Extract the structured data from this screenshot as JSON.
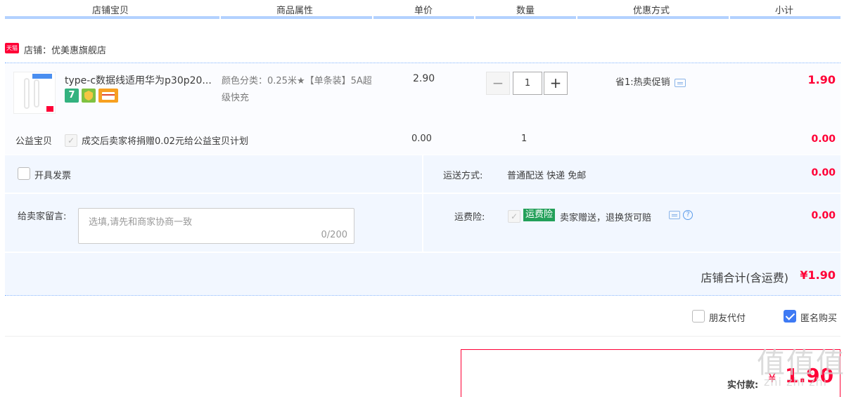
{
  "header": {
    "col_shop_item": "店铺宝贝",
    "col_attr": "商品属性",
    "col_price": "单价",
    "col_qty": "数量",
    "col_promo": "优惠方式",
    "col_subtotal": "小计"
  },
  "shop": {
    "badge": "天猫",
    "name": "店铺：优美惠旗舰店"
  },
  "item": {
    "title": "type-c数据线适用华为p30p20...",
    "attr": "颜色分类：0.25米★【单条装】5A超级快充",
    "price": "2.90",
    "qty": "1",
    "minus": "−",
    "plus": "+",
    "promo": "省1:热卖促销",
    "subtotal": "1.90",
    "icons": [
      "seven-day-return-icon",
      "shield-icon",
      "card-icon"
    ],
    "icon_7_text": "7"
  },
  "charity": {
    "label": "公益宝贝",
    "check": "✓",
    "text": "成交后卖家将捐赠0.02元给公益宝贝计划",
    "price": "0.00",
    "qty": "1",
    "subtotal": "0.00"
  },
  "invoice": {
    "label": "开具发票"
  },
  "shipping": {
    "label": "运送方式:",
    "method": "普通配送 快递 免邮",
    "cost": "0.00"
  },
  "message": {
    "label": "给卖家留言:",
    "placeholder": "选填,请先和商家协商一致",
    "counter": "0/200"
  },
  "insurance": {
    "label": "运费险:",
    "check": "✓",
    "tag": "运费险",
    "desc": "卖家赠送，退换货可赔",
    "help": "?",
    "cost": "0.00"
  },
  "total": {
    "label": "店铺合计(含运费)",
    "value": "¥1.90"
  },
  "options": {
    "friend_pay": "朋友代付",
    "anonymous": "匿名购买",
    "friend_pay_checked": false,
    "anonymous_checked": true
  },
  "payment": {
    "label": "实付款:",
    "currency": "¥",
    "amount": "1.90"
  },
  "watermark": {
    "big": "值值值",
    "small": "zhi zhi zhi"
  },
  "colors": {
    "accent_red": "#ff0036",
    "header_bar": "#b2d1ff",
    "block_bg": "#f2f7ff",
    "check_blue": "#3e7af4",
    "insurance_green": "#23a05a"
  }
}
